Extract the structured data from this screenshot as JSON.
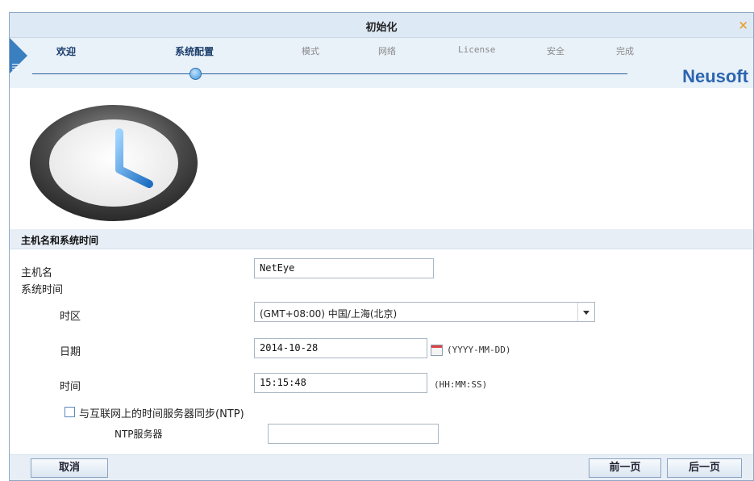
{
  "window": {
    "title": "初始化",
    "close_icon": "×"
  },
  "wizard": {
    "steps": [
      {
        "label": "欢迎",
        "state": "done"
      },
      {
        "label": "系统配置",
        "state": "current"
      },
      {
        "label": "模式",
        "state": "todo"
      },
      {
        "label": "网络",
        "state": "todo"
      },
      {
        "label": "License",
        "state": "todo"
      },
      {
        "label": "安全",
        "state": "todo"
      },
      {
        "label": "完成",
        "state": "todo"
      }
    ],
    "brand": "Neusoft"
  },
  "section": {
    "title": "主机名和系统时间"
  },
  "form": {
    "hostname_label": "主机名",
    "hostname_value": "NetEye",
    "system_time_label": "系统时间",
    "timezone_label": "时区",
    "timezone_value": "(GMT+08:00) 中国/上海(北京)",
    "date_label": "日期",
    "date_value": "2014-10-28",
    "date_format": "(YYYY-MM-DD)",
    "time_label": "时间",
    "time_value": "15:15:48",
    "time_format": "(HH:MM:SS)",
    "ntp_sync_label": "与互联网上的时间服务器同步(NTP)",
    "ntp_sync_checked": false,
    "ntp_server_label": "NTP服务器",
    "ntp_server_value": ""
  },
  "footer": {
    "cancel_label": "取消",
    "prev_label": "前一页",
    "next_label": "后一页"
  },
  "colors": {
    "accent": "#2b65b0",
    "close": "#e8a23a"
  }
}
